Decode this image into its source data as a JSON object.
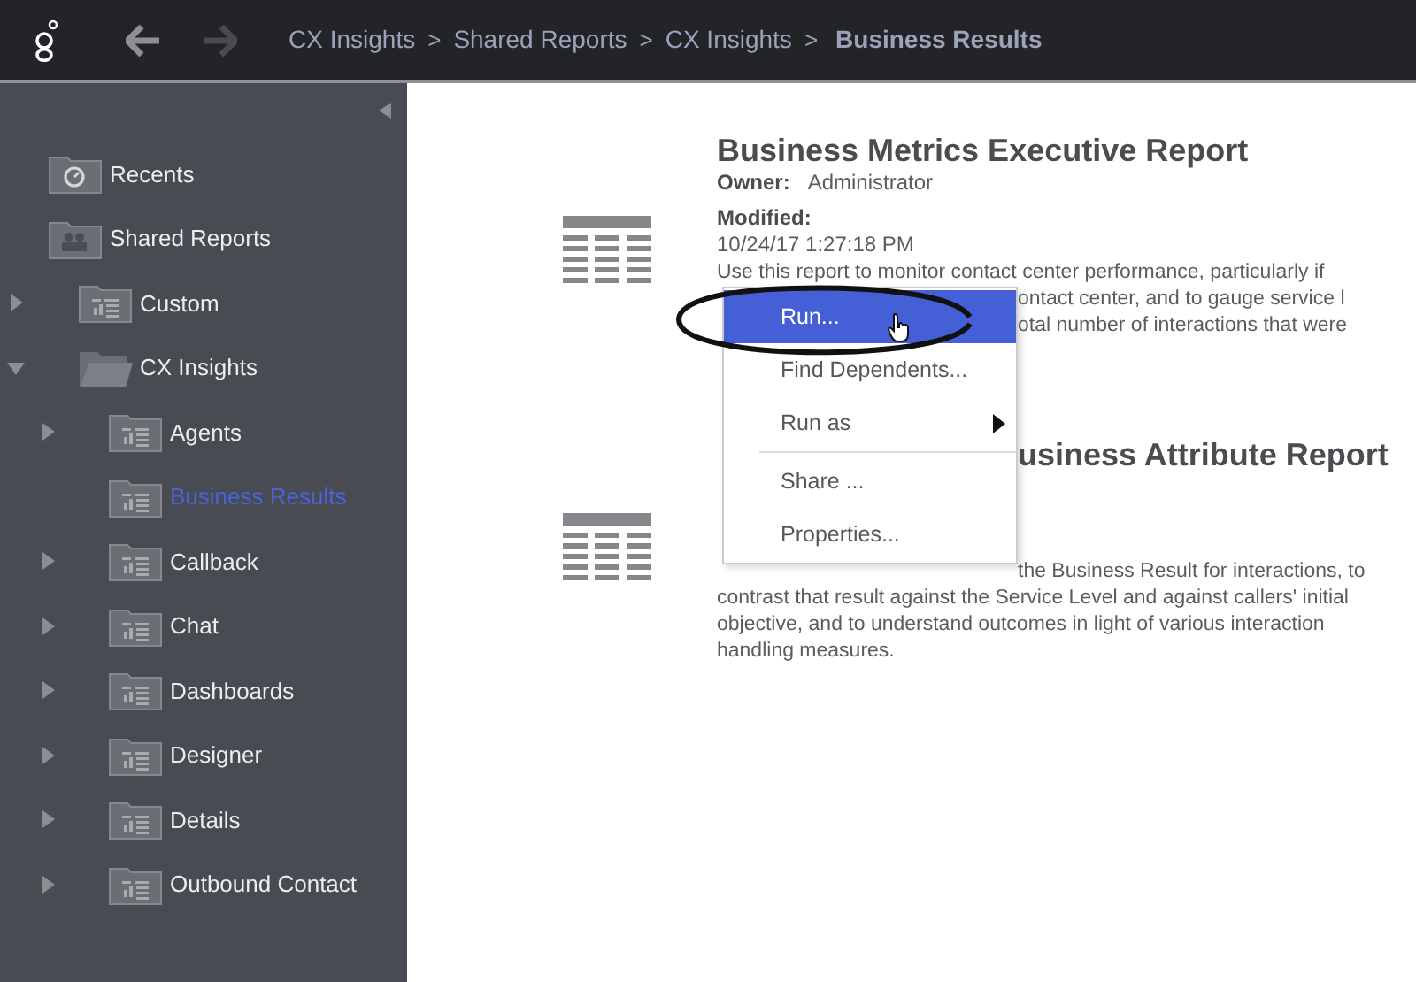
{
  "header": {
    "breadcrumb": [
      {
        "label": "CX Insights",
        "current": false
      },
      {
        "label": ">",
        "kind": "separator"
      },
      {
        "label": "Shared Reports",
        "current": false
      },
      {
        "label": ">",
        "kind": "separator"
      },
      {
        "label": "CX Insights",
        "current": false
      },
      {
        "label": ">",
        "kind": "separator"
      },
      {
        "label": "Business Results",
        "current": true
      }
    ],
    "forward_disabled": true
  },
  "sidebar": {
    "items": [
      {
        "label": "Recents",
        "kind": "recents",
        "selected": false
      },
      {
        "label": "Shared Reports",
        "kind": "shared",
        "selected": false,
        "children": [
          {
            "label": "Custom",
            "kind": "folder",
            "expanded": false,
            "selected": false
          },
          {
            "label": "CX Insights",
            "kind": "folder",
            "expanded": true,
            "selected": false,
            "children": [
              {
                "label": "Agents",
                "kind": "folder",
                "expanded": false,
                "selected": false
              },
              {
                "label": "Business Results",
                "kind": "folder",
                "selected": true
              },
              {
                "label": "Callback",
                "kind": "folder",
                "expanded": false,
                "selected": false
              },
              {
                "label": "Chat",
                "kind": "folder",
                "expanded": false,
                "selected": false
              },
              {
                "label": "Dashboards",
                "kind": "folder",
                "expanded": false,
                "selected": false
              },
              {
                "label": "Designer",
                "kind": "folder",
                "expanded": false,
                "selected": false
              },
              {
                "label": "Details",
                "kind": "folder",
                "expanded": false,
                "selected": false
              },
              {
                "label": "Outbound Contact",
                "kind": "folder",
                "expanded": false,
                "selected": false
              }
            ]
          }
        ]
      }
    ]
  },
  "reports": [
    {
      "title": "Business Metrics Executive Report",
      "owner_label": "Owner:",
      "owner": "Administrator",
      "modified_label": "Modified:",
      "modified": "10/24/17 1:27:18 PM",
      "description": [
        "Use this report to monitor contact center performance, particularly if",
        "ontact center, and to gauge service l",
        "otal number of interactions that were"
      ]
    },
    {
      "title": "usiness Attribute Report",
      "description": [
        "the Business Result for interactions, to",
        "contrast that result against the Service Level and against callers' initial",
        "objective, and to understand outcomes in light of various interaction",
        "handling measures."
      ]
    }
  ],
  "context_menu": {
    "items": [
      {
        "label": "Run...",
        "selected": true
      },
      {
        "label": "Find Dependents...",
        "selected": false
      },
      {
        "label": "Run as",
        "selected": false,
        "submenu": true
      },
      {
        "kind": "separator"
      },
      {
        "label": "Share ...",
        "selected": false
      },
      {
        "label": "Properties...",
        "selected": false
      }
    ]
  }
}
